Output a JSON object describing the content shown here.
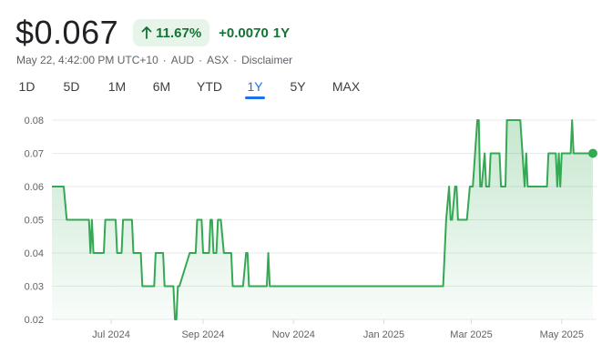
{
  "quote": {
    "price": "$0.067",
    "change_percent": "11.67%",
    "change_value": "+0.0070",
    "change_period": "1Y"
  },
  "meta": {
    "datetime": "May 22, 4:42:00 PM UTC+10",
    "currency": "AUD",
    "exchange": "ASX",
    "disclaimer": "Disclaimer",
    "separator": "·"
  },
  "tabs": [
    {
      "label": "1D"
    },
    {
      "label": "5D"
    },
    {
      "label": "1M"
    },
    {
      "label": "6M"
    },
    {
      "label": "YTD"
    },
    {
      "label": "1Y"
    },
    {
      "label": "5Y"
    },
    {
      "label": "MAX"
    }
  ],
  "active_tab": "1Y",
  "colors": {
    "line": "#34a853",
    "up": "#137333",
    "pill_bg": "#e6f4ea",
    "active_tab": "#1a73e8",
    "grid": "#e8eaed"
  },
  "chart_data": {
    "type": "area",
    "title": "",
    "xlabel": "",
    "ylabel": "",
    "grid": true,
    "ylim": [
      0.02,
      0.08
    ],
    "yticks": [
      0.08,
      0.07,
      0.06,
      0.05,
      0.04,
      0.03,
      0.02
    ],
    "ytick_labels": [
      "0.08",
      "0.07",
      "0.06",
      "0.05",
      "0.04",
      "0.03",
      "0.02"
    ],
    "xlim": [
      "2024-05-22",
      "2025-05-22"
    ],
    "xticks": [
      "2024-07-01",
      "2024-09-01",
      "2024-11-01",
      "2025-01-01",
      "2025-03-01",
      "2025-05-01"
    ],
    "xtick_labels": [
      "Jul 2024",
      "Sep 2024",
      "Nov 2024",
      "Jan 2025",
      "Mar 2025",
      "May 2025"
    ],
    "series": [
      {
        "x": [
          "2024-05-22",
          "2024-05-30",
          "2024-06-01",
          "2024-06-16",
          "2024-06-17",
          "2024-06-18",
          "2024-06-19",
          "2024-06-20",
          "2024-06-26",
          "2024-06-27",
          "2024-06-30",
          "2024-07-04",
          "2024-07-05",
          "2024-07-08",
          "2024-07-09",
          "2024-07-15",
          "2024-07-16",
          "2024-07-21",
          "2024-07-22",
          "2024-07-30",
          "2024-07-31",
          "2024-08-05",
          "2024-08-06",
          "2024-08-12",
          "2024-08-13",
          "2024-08-14",
          "2024-08-15",
          "2024-08-16",
          "2024-08-23",
          "2024-08-24",
          "2024-08-25",
          "2024-08-27",
          "2024-08-28",
          "2024-08-31",
          "2024-09-01",
          "2024-09-05",
          "2024-09-06",
          "2024-09-07",
          "2024-09-08",
          "2024-09-10",
          "2024-09-11",
          "2024-09-13",
          "2024-09-15",
          "2024-09-16",
          "2024-09-17",
          "2024-09-20",
          "2024-09-21",
          "2024-09-22",
          "2024-09-28",
          "2024-09-30",
          "2024-10-01",
          "2024-10-02",
          "2024-10-10",
          "2024-10-11",
          "2024-10-12",
          "2024-10-14",
          "2024-10-15",
          "2024-10-16",
          "2024-10-17",
          "2025-02-10",
          "2025-02-12",
          "2025-02-14",
          "2025-02-15",
          "2025-02-16",
          "2025-02-18",
          "2025-02-19",
          "2025-02-20",
          "2025-02-26",
          "2025-02-28",
          "2025-03-01",
          "2025-03-02",
          "2025-03-05",
          "2025-03-06",
          "2025-03-07",
          "2025-03-08",
          "2025-03-10",
          "2025-03-11",
          "2025-03-13",
          "2025-03-14",
          "2025-03-20",
          "2025-03-21",
          "2025-03-24",
          "2025-03-25",
          "2025-03-27",
          "2025-04-03",
          "2025-04-06",
          "2025-04-07",
          "2025-04-08",
          "2025-04-09",
          "2025-04-10",
          "2025-04-20",
          "2025-04-21",
          "2025-04-22",
          "2025-04-23",
          "2025-04-27",
          "2025-04-28",
          "2025-04-29",
          "2025-04-30",
          "2025-05-01",
          "2025-05-07",
          "2025-05-08",
          "2025-05-09",
          "2025-05-10",
          "2025-05-11",
          "2025-05-15",
          "2025-05-22"
        ],
        "values": [
          0.06,
          0.06,
          0.05,
          0.05,
          0.04,
          0.05,
          0.04,
          0.04,
          0.04,
          0.05,
          0.05,
          0.05,
          0.04,
          0.04,
          0.05,
          0.05,
          0.04,
          0.04,
          0.03,
          0.03,
          0.04,
          0.04,
          0.03,
          0.03,
          0.02,
          0.02,
          0.03,
          0.03,
          0.04,
          0.04,
          0.04,
          0.04,
          0.05,
          0.05,
          0.04,
          0.04,
          0.05,
          0.05,
          0.04,
          0.04,
          0.05,
          0.05,
          0.04,
          0.04,
          0.04,
          0.04,
          0.03,
          0.03,
          0.03,
          0.04,
          0.04,
          0.03,
          0.03,
          0.03,
          0.03,
          0.03,
          0.04,
          0.03,
          0.03,
          0.03,
          0.05,
          0.06,
          0.05,
          0.05,
          0.06,
          0.06,
          0.05,
          0.05,
          0.06,
          0.06,
          0.06,
          0.08,
          0.08,
          0.06,
          0.06,
          0.07,
          0.06,
          0.06,
          0.07,
          0.07,
          0.06,
          0.06,
          0.08,
          0.08,
          0.08,
          0.06,
          0.07,
          0.06,
          0.06,
          0.06,
          0.06,
          0.06,
          0.07,
          0.07,
          0.07,
          0.06,
          0.07,
          0.06,
          0.07,
          0.07,
          0.08,
          0.07,
          0.07,
          0.07,
          0.07,
          0.07
        ]
      }
    ]
  }
}
